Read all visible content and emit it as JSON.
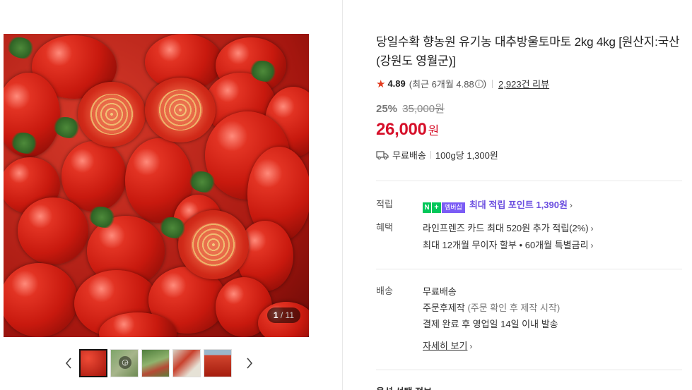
{
  "gallery": {
    "counter_current": "1",
    "counter_total": "11",
    "counter_sep": "/",
    "main_image_name": "cherry-tomatoes"
  },
  "product": {
    "title": "당일수확 향농원 유기농 대추방울토마토 2kg 4kg [원산지:국산(강원도 영월군)]",
    "rating": {
      "score": "4.89",
      "recent": "(최근 6개월 4.88",
      "recent_close": ")",
      "review_count": "2,923건 리뷰"
    },
    "discount_percent": "25%",
    "original_price": "35,000원",
    "price": "26,000",
    "currency": "원",
    "shipping": "무료배송",
    "unit_price": "100g당 1,300원"
  },
  "benefits": {
    "points_label": "적립",
    "badge_n": "N",
    "badge_plus": "+",
    "badge_member": "멤버십",
    "points_text": "최대 적립 포인트",
    "points_value": "1,390원",
    "perks_label": "혜택",
    "perk1": "라인프렌즈 카드 최대 520원 추가 적립(2%)",
    "perk2": "최대 12개월 무이자 할부 • 60개월 특별금리"
  },
  "delivery": {
    "label": "배송",
    "line1": "무료배송",
    "line2_main": "주문후제작",
    "line2_sub": "(주문 확인 후 제작 시작)",
    "line3": "결제 완료 후 영업일 14일 이내 발송",
    "detail_link": "자세히 보기"
  },
  "bottom_partial": "옵션 선택 정보",
  "colors": {
    "price_red": "#d6102a",
    "star": "#e23a1d",
    "naver_green": "#03c75a",
    "membership_purple": "#7b5cf5"
  }
}
